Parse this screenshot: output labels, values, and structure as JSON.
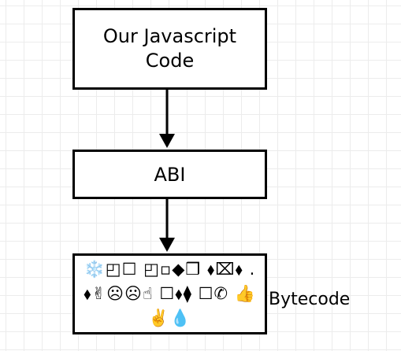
{
  "diagram": {
    "nodes": {
      "source": {
        "label": "Our Javascript Code"
      },
      "abi": {
        "label": "ABI"
      },
      "bytecode": {
        "label": "❄️◰☐ ◰▫︎◆❒ ⬧⌧⬧ . ⬧✌︎☹︎☹︎☝︎ ☐⬧⧫ ☐✆ 👍✌️💧"
      }
    },
    "bytecode_caption": "Bytecode",
    "edges": [
      {
        "from": "source",
        "to": "abi"
      },
      {
        "from": "abi",
        "to": "bytecode"
      }
    ],
    "colors": {
      "stroke": "#000000",
      "grid": "#ececec",
      "background": "#ffffff"
    }
  }
}
